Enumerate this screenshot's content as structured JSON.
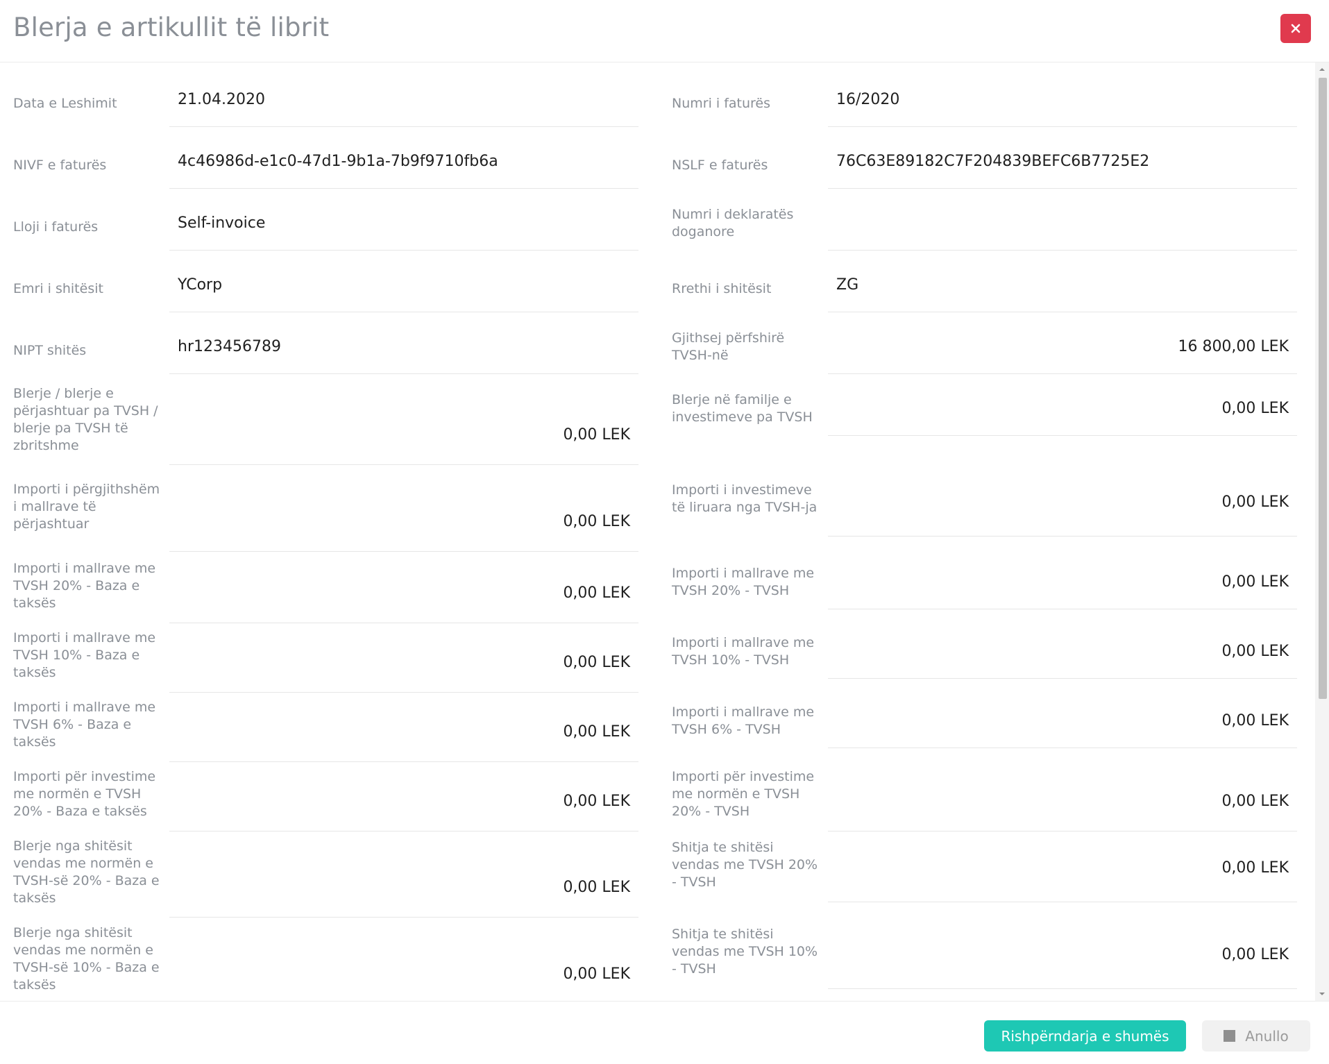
{
  "dialog": {
    "title": "Blerja e artikullit të librit",
    "close_icon": "close-icon"
  },
  "left_fields": [
    {
      "label": "Data e Leshimit",
      "value": "21.04.2020"
    },
    {
      "label": "NIVF e faturës",
      "value": "4c46986d-e1c0-47d1-9b1a-7b9f9710fb6a"
    },
    {
      "label": "Lloji i faturës",
      "value": "Self-invoice"
    },
    {
      "label": "Emri i shitësit",
      "value": "YCorp"
    },
    {
      "label": "NIPT shitës",
      "value": "hr123456789"
    },
    {
      "label": "Blerje / blerje e përjashtuar pa TVSH / blerje pa TVSH të zbritshme",
      "value": "0,00 LEK"
    },
    {
      "label": "Importi i përgjithshëm i mallrave të përjashtuar",
      "value": "0,00 LEK"
    },
    {
      "label": "Importi i mallrave me TVSH 20% - Baza e taksës",
      "value": "0,00 LEK"
    },
    {
      "label": "Importi i mallrave me TVSH 10% - Baza e taksës",
      "value": "0,00 LEK"
    },
    {
      "label": "Importi i mallrave me TVSH 6% - Baza e taksës",
      "value": "0,00 LEK"
    },
    {
      "label": "Importi për investime me normën e TVSH 20% - Baza e taksës",
      "value": "0,00 LEK"
    },
    {
      "label": "Blerje nga shitësit vendas me normën e TVSH-së  20% - Baza e taksës",
      "value": "0,00 LEK"
    },
    {
      "label": "Blerje nga shitësit vendas me normën e TVSH-së  10% - Baza e taksës",
      "value": "0,00 LEK"
    }
  ],
  "right_fields": [
    {
      "label": "Numri i faturës",
      "value": "16/2020"
    },
    {
      "label": "NSLF e faturës",
      "value": "76C63E89182C7F204839BEFC6B7725E2"
    },
    {
      "label": "Numri i deklaratës doganore",
      "value": ""
    },
    {
      "label": "Rrethi i shitësit",
      "value": "ZG"
    },
    {
      "label": "Gjithsej përfshirë TVSH-në",
      "value": "16 800,00 LEK"
    },
    {
      "label": "Blerje në familje e investimeve pa TVSH",
      "value": "0,00 LEK"
    },
    {
      "label": "Importi i investimeve të liruara nga TVSH-ja",
      "value": "0,00 LEK"
    },
    {
      "label": "Importi i mallrave me TVSH 20% - TVSH",
      "value": "0,00 LEK"
    },
    {
      "label": "Importi i mallrave me TVSH 10% - TVSH",
      "value": "0,00 LEK"
    },
    {
      "label": "Importi i mallrave me TVSH 6% - TVSH",
      "value": "0,00 LEK"
    },
    {
      "label": "Importi për investime me normën e TVSH 20% - TVSH",
      "value": "0,00 LEK"
    },
    {
      "label": "Shitja te shitësi vendas me TVSH 20% - TVSH",
      "value": "0,00 LEK"
    },
    {
      "label": "Shitja te shitësi vendas me TVSH 10% - TVSH",
      "value": "0,00 LEK"
    }
  ],
  "footer": {
    "redistribute_label": "Rishpërndarja e shumës",
    "cancel_label": "Anullo",
    "cancel_icon": "stop-icon"
  },
  "colors": {
    "primary": "#1ec8b4",
    "close": "#e03a4e",
    "label": "#8a8f96"
  }
}
